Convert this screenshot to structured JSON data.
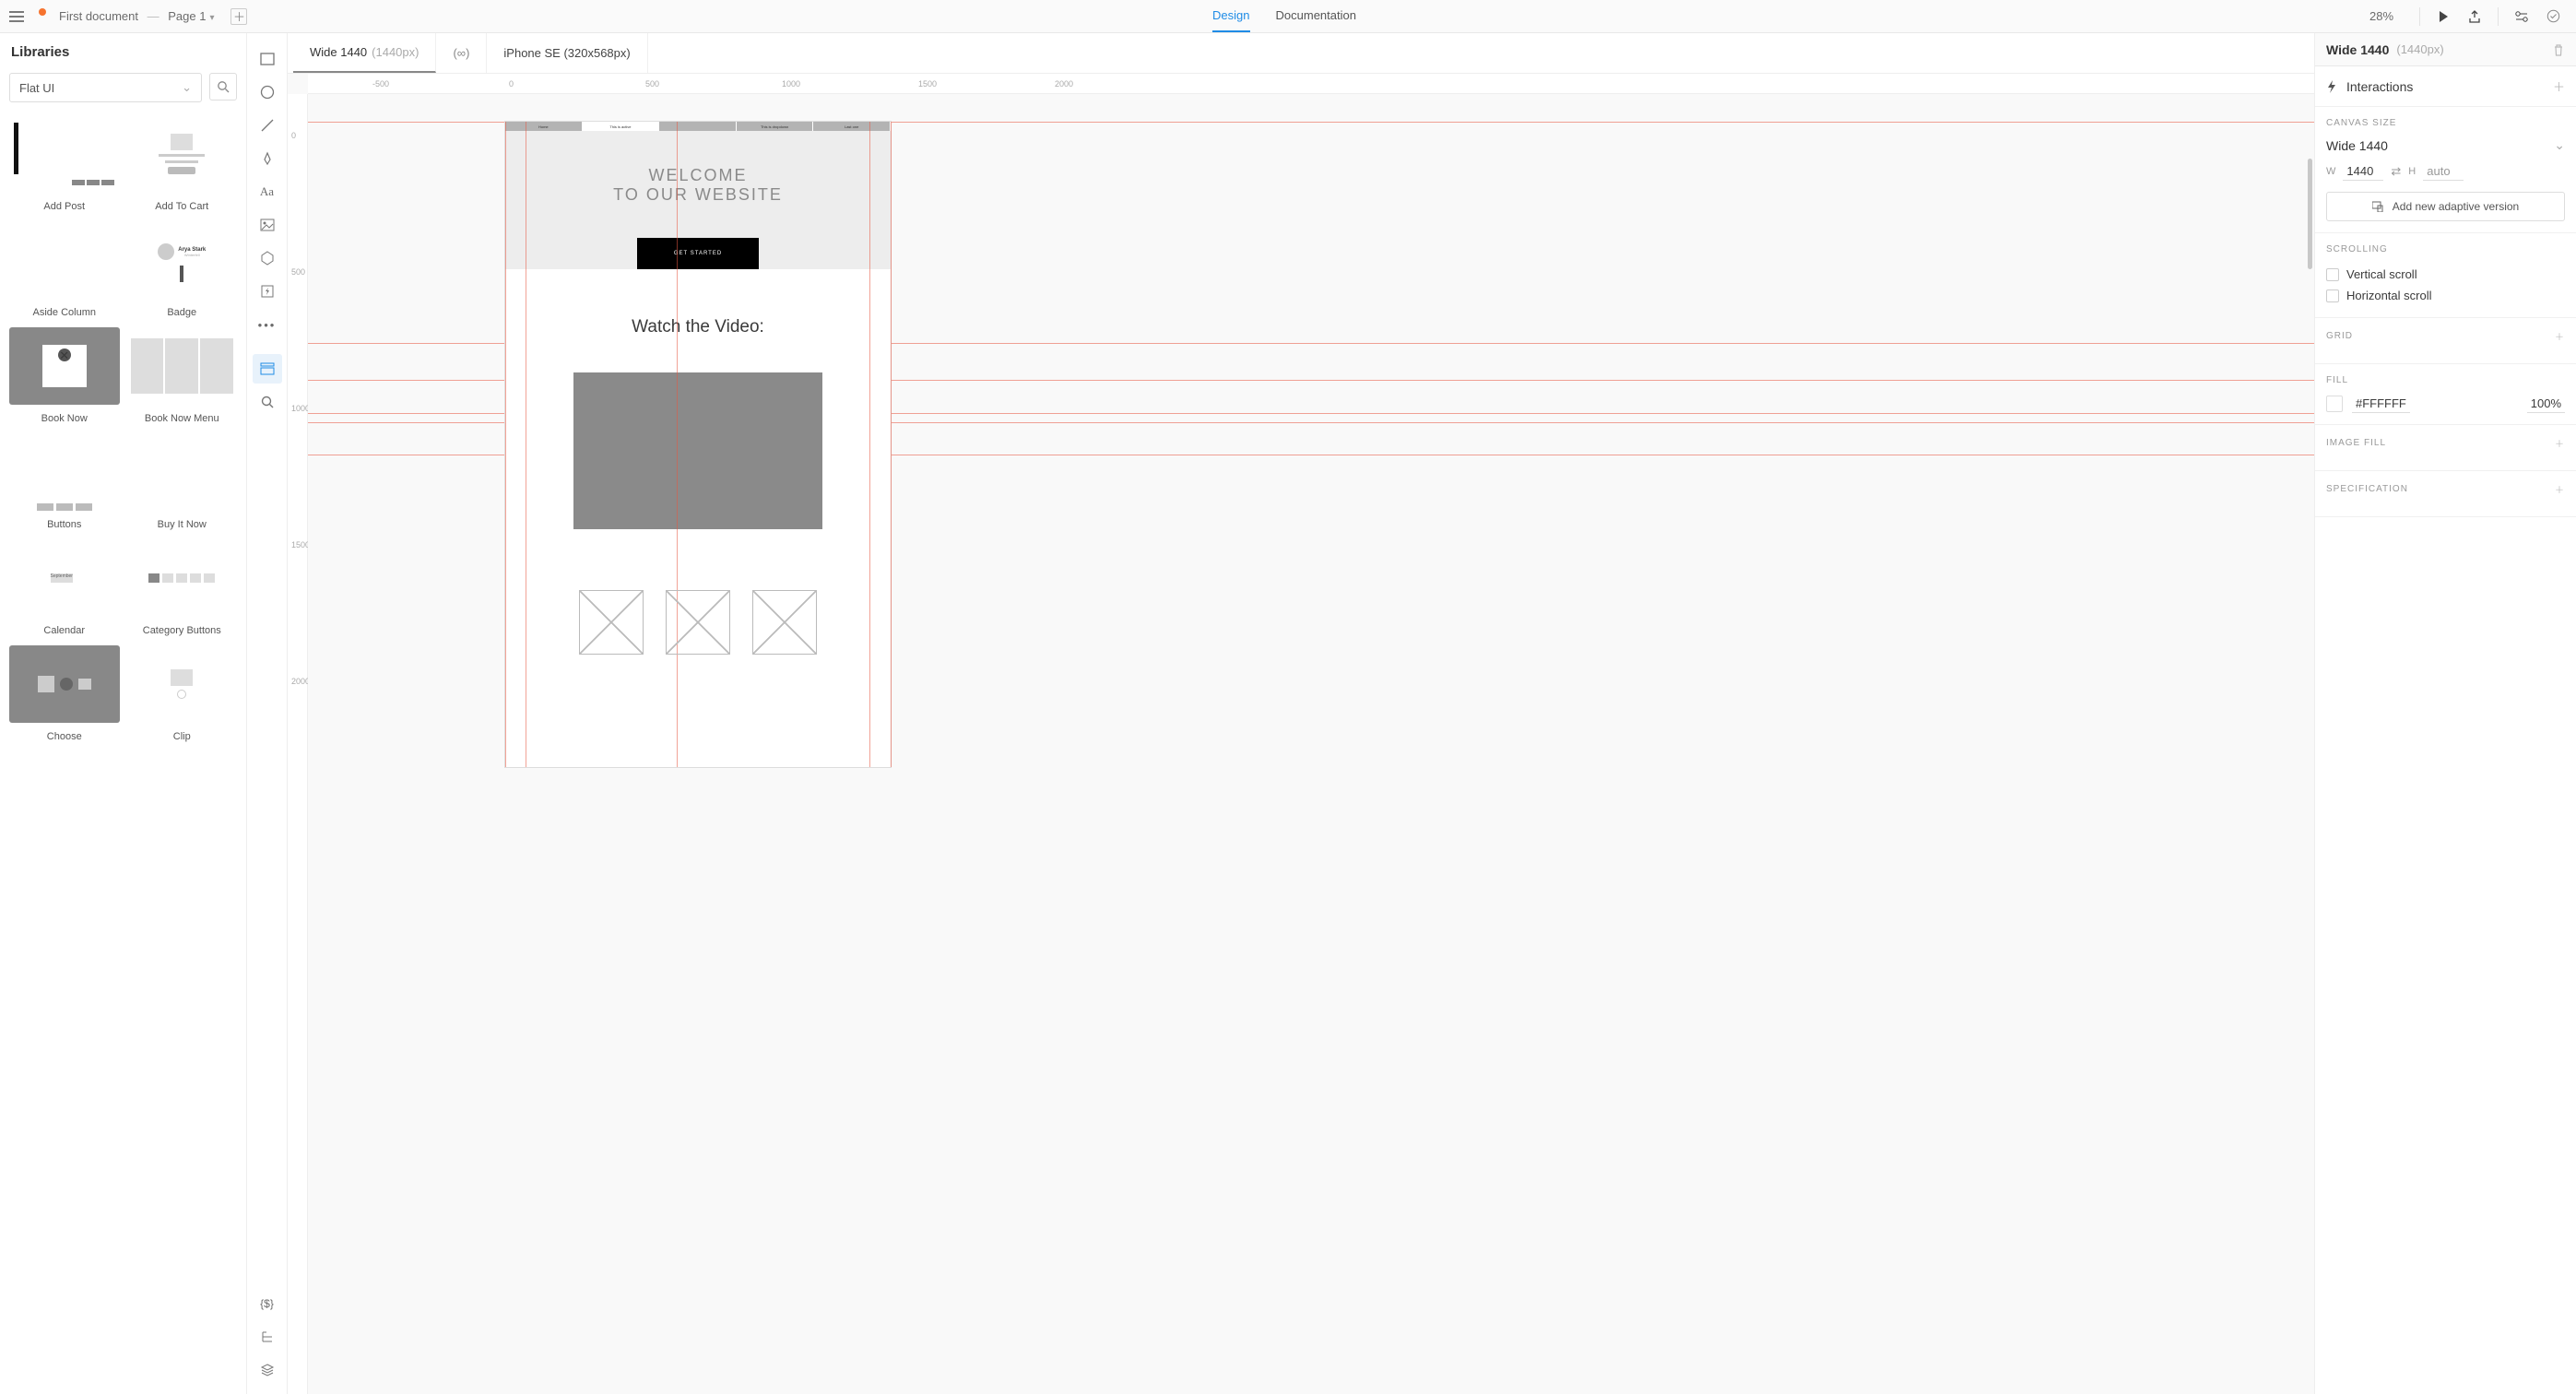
{
  "topbar": {
    "doc_name": "First document",
    "page_label": "Page 1",
    "tabs": {
      "design": "Design",
      "documentation": "Documentation"
    },
    "zoom": "28%"
  },
  "libraries": {
    "title": "Libraries",
    "selected": "Flat UI",
    "items": [
      {
        "name": "Add Post"
      },
      {
        "name": "Add To Cart"
      },
      {
        "name": "Aside Column"
      },
      {
        "name": "Badge"
      },
      {
        "name": "Book Now"
      },
      {
        "name": "Book Now Menu"
      },
      {
        "name": "Buttons"
      },
      {
        "name": "Buy It Now"
      },
      {
        "name": "Calendar"
      },
      {
        "name": "Category Buttons"
      },
      {
        "name": "Choose"
      },
      {
        "name": "Clip"
      }
    ]
  },
  "ruler_h": [
    "-500",
    "0",
    "500",
    "1000",
    "1500",
    "2000"
  ],
  "ruler_v": [
    "0",
    "500",
    "1000",
    "1500",
    "2000"
  ],
  "canvas_tabs": {
    "wide": {
      "label": "Wide 1440",
      "dim": "(1440px)"
    },
    "infinity": "(∞)",
    "iphone": "iPhone SE (320x568px)"
  },
  "artboard": {
    "nav": [
      "Home",
      "This is active",
      "",
      "This is dropdown",
      "Last one"
    ],
    "nav_active_index": 1,
    "hero_line1": "WELCOME",
    "hero_line2": "TO OUR WEBSITE",
    "hero_btn": "GET STARTED",
    "video_title": "Watch the Video:"
  },
  "right_panel": {
    "header_title": "Wide 1440",
    "header_dim": "(1440px)",
    "interactions_label": "Interactions",
    "canvas_size_label": "CANVAS SIZE",
    "canvas_size_value": "Wide 1440",
    "width_value": "1440",
    "height_value": "auto",
    "add_adaptive": "Add new adaptive version",
    "scrolling_label": "SCROLLING",
    "vertical_scroll": "Vertical scroll",
    "horizontal_scroll": "Horizontal scroll",
    "grid_label": "GRID",
    "fill_label": "FILL",
    "fill_value": "#FFFFFF",
    "fill_opacity": "100%",
    "image_fill_label": "IMAGE FILL",
    "specification_label": "SPECIFICATION"
  }
}
